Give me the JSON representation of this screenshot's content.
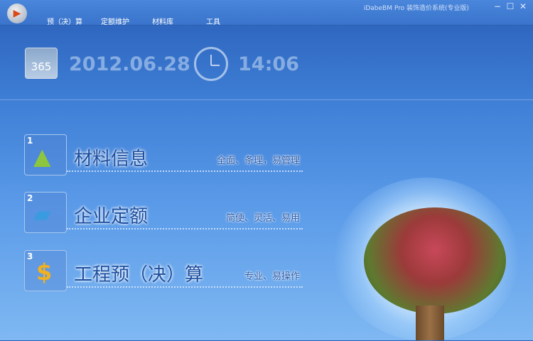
{
  "titlebar": {
    "app_title": "iDabeBM Pro  装饰造价系统(专业版)",
    "menu": [
      "预（决）算",
      "定额维护",
      "材料库",
      "工具"
    ],
    "minimize": "−",
    "maximize": "☐",
    "close": "✕"
  },
  "header": {
    "calendar_label": "365",
    "date": "2012.06.28",
    "time": "14:06"
  },
  "items": [
    {
      "num": "1",
      "title": "材料信息",
      "subtitle": "全面、条理，易管理",
      "icon": "pyramid-icon"
    },
    {
      "num": "2",
      "title": "企业定额",
      "subtitle": "简便、灵活、易用",
      "icon": "books-icon"
    },
    {
      "num": "3",
      "title": "工程预（决）算",
      "subtitle": "专业、易操作",
      "icon": "dollar-icon"
    }
  ]
}
